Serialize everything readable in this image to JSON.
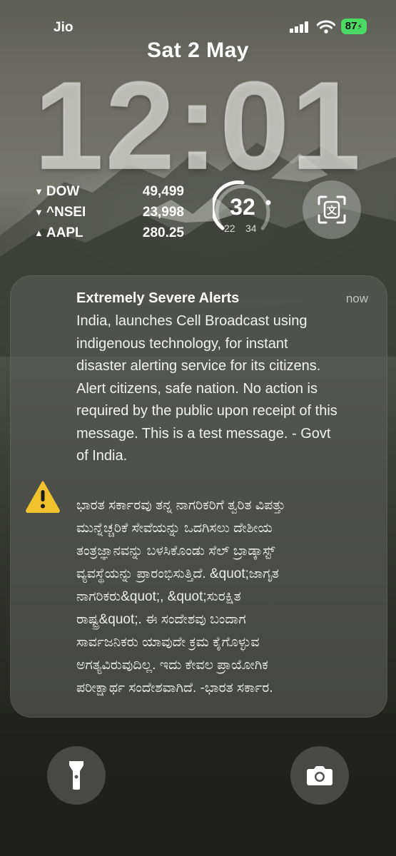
{
  "status_bar": {
    "carrier": "Jio",
    "battery": "87",
    "battery_color": "#4cd964"
  },
  "lock_screen": {
    "date": "Sat 2 May",
    "time": "12:01"
  },
  "stocks_widget": {
    "items": [
      {
        "direction": "down",
        "symbol": "DOW",
        "value": "49,499"
      },
      {
        "direction": "down",
        "symbol": "^NSEI",
        "value": "23,998"
      },
      {
        "direction": "up",
        "symbol": "AAPL",
        "value": "280.25"
      }
    ]
  },
  "weather_widget": {
    "temperature": "32",
    "low": "22",
    "high": "34",
    "level": 0.5
  },
  "scan_widget": {
    "icon": "translate-scan-icon"
  },
  "notification": {
    "title": "Extremely Severe Alerts",
    "time": "now",
    "icon": "warning-icon",
    "icon_color": "#f2c12e",
    "body_english": "India, launches Cell Broadcast using\nindigenous technology, for instant\ndisaster alerting service for its citizens.\nAlert citizens, safe nation. No action is\nrequired by the public upon receipt of this\nmessage. This is a test message. - Govt\nof India.",
    "body_kannada": "ಭಾರತ ಸರ್ಕಾರವು ತನ್ನ ನಾಗರಿಕರಿಗೆ ತ್ವರಿತ ವಿಪತ್ತು\nಮುನ್ನೆಚ್ಚರಿಕೆ ಸೇವೆಯನ್ನು ಒದಗಿಸಲು ದೇಶೀಯ\nತಂತ್ರಜ್ಞಾನವನ್ನು ಬಳಸಿಕೊಂಡು ಸೆಲ್ ಬ್ರಾಡ್ಕಾಸ್ಟ್\nವ್ಯವಸ್ಥೆಯನ್ನು ಪ್ರಾರಂಭಿಸುತ್ತಿದೆ. &quot;ಜಾಗೃತ\nನಾಗರಿಕರು&quot;, &quot;ಸುರಕ್ಷಿತ\nರಾಷ್ಟ್ರ&quot;. ಈ ಸಂದೇಶವು ಬಂದಾಗ\nಸಾರ್ವಜನಿಕರು ಯಾವುದೇ ಕ್ರಮ ಕೈಗೊಳ್ಳುವ\nಅಗತ್ಯವಿರುವುದಿಲ್ಲ. ಇದು ಕೇವಲ ಪ್ರಾಯೋಗಿಕ\nಪರೀಕ್ಷಾರ್ಥ ಸಂದೇಶವಾಗಿದೆ. -ಭಾರತ ಸರ್ಕಾರ."
  },
  "quick_actions": {
    "left": "flashlight-icon",
    "right": "camera-icon"
  }
}
